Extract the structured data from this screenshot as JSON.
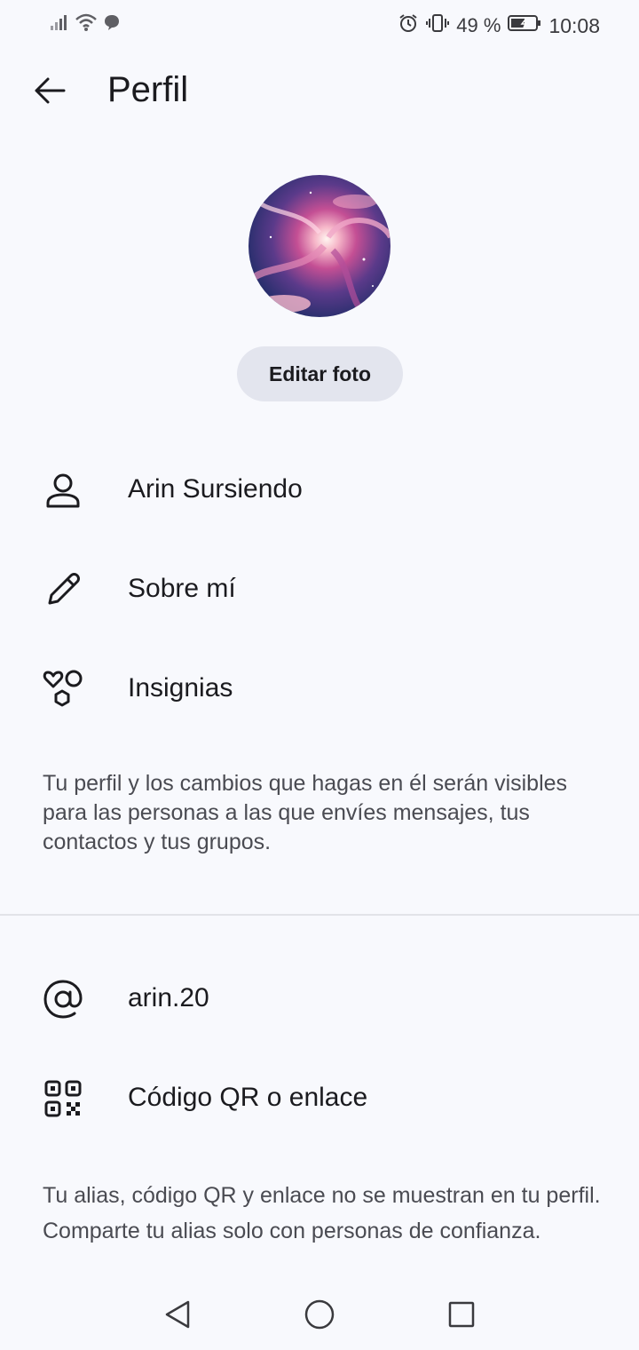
{
  "status_bar": {
    "battery_percent": "49 %",
    "time": "10:08",
    "icons": [
      "signal-icon",
      "wifi-icon",
      "chat-bubble-icon",
      "alarm-icon",
      "vibrate-icon",
      "battery-icon"
    ]
  },
  "header": {
    "title": "Perfil",
    "back_icon": "back-arrow-icon"
  },
  "profile": {
    "edit_photo_label": "Editar foto"
  },
  "rows_primary": [
    {
      "icon": "person-icon",
      "label": "Arin Sursiendo"
    },
    {
      "icon": "pencil-icon",
      "label": "Sobre mí"
    },
    {
      "icon": "badges-icon",
      "label": "Insignias"
    }
  ],
  "note_primary": "Tu perfil y los cambios que hagas en él serán visibles para las personas a las que envíes mensajes, tus contactos y tus grupos.",
  "rows_secondary": [
    {
      "icon": "at-sign-icon",
      "label": "arin.20"
    },
    {
      "icon": "qr-code-icon",
      "label": "Código QR o enlace"
    }
  ],
  "note_secondary": "Tu alias, código QR y enlace no se muestran en tu perfil. Comparte tu alias solo con personas de confianza.",
  "nav_bar": {
    "icons": [
      "nav-back-icon",
      "nav-home-icon",
      "nav-recents-icon"
    ]
  },
  "colors": {
    "background": "#f8f9fd",
    "button_bg": "#e3e5ee",
    "text": "#1b1b1f",
    "secondary_text": "#4a4b52"
  }
}
